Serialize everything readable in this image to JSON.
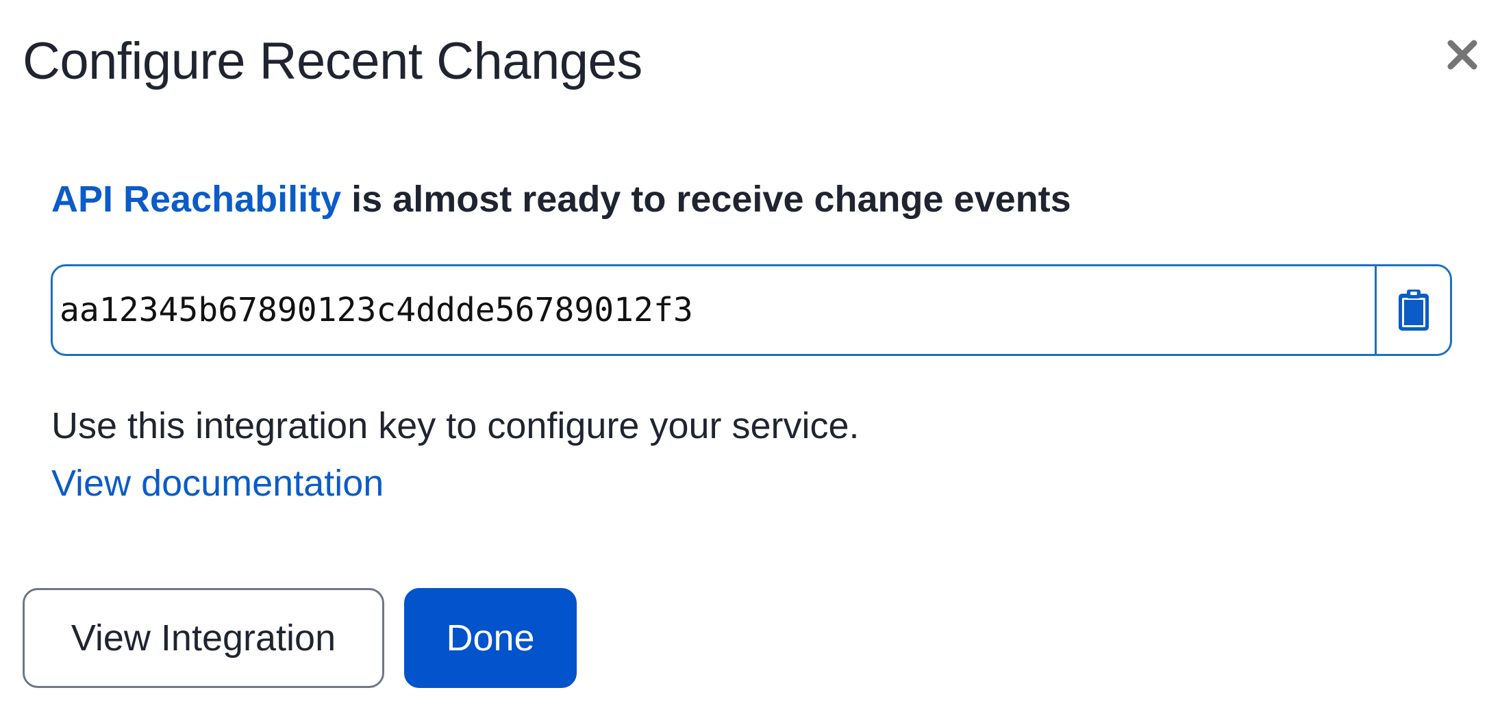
{
  "dialog": {
    "title": "Configure Recent Changes",
    "close_icon": "close-icon"
  },
  "status": {
    "service_name": "API Reachability",
    "message": " is almost ready to receive change events"
  },
  "integration_key": {
    "value": "aa12345b67890123c4ddde56789012f3",
    "copy_icon": "clipboard-icon"
  },
  "help": {
    "text": "Use this integration key to configure your service.",
    "doc_link": "View documentation"
  },
  "actions": {
    "view_integration_label": "View Integration",
    "done_label": "Done"
  },
  "colors": {
    "link": "#0b5cc7",
    "primary_button": "#0353cc",
    "input_border": "#1b6fbf",
    "text": "#1f2430"
  }
}
